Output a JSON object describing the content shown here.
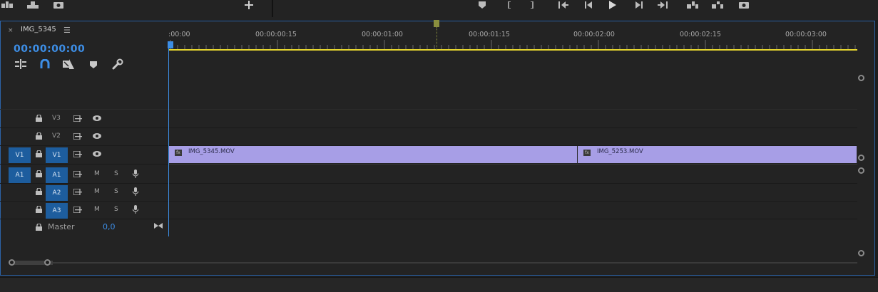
{
  "sequence": {
    "tab_title": "IMG_5345",
    "tab_close": "×",
    "tab_menu": "☰",
    "timecode": "00:00:00:00"
  },
  "ruler": {
    "labels": [
      ":00:00",
      "00:00:00:15",
      "00:00:01:00",
      "00:00:01:15",
      "00:00:02:00",
      "00:00:02:15",
      "00:00:03:00"
    ]
  },
  "tracks": {
    "video": [
      {
        "name": "V3",
        "target": "",
        "source_patch": ""
      },
      {
        "name": "V2",
        "target": "",
        "source_patch": ""
      },
      {
        "name": "V1",
        "target": "V1",
        "source_patch": "V1"
      }
    ],
    "audio": [
      {
        "name": "A1",
        "source_patch": "A1",
        "target": "A1",
        "mute": "M",
        "solo": "S"
      },
      {
        "name": "A2",
        "source_patch": "",
        "target": "A2",
        "mute": "M",
        "solo": "S"
      },
      {
        "name": "A3",
        "source_patch": "",
        "target": "A3",
        "mute": "M",
        "solo": "S"
      }
    ],
    "master": {
      "label": "Master",
      "value": "0,0"
    }
  },
  "clips": [
    {
      "name": "IMG_5345.MOV",
      "track": "V1",
      "fx": "fx"
    },
    {
      "name": "IMG_5253.MOV",
      "track": "V1",
      "fx": "fx"
    }
  ],
  "colors": {
    "accent": "#3d8ee6",
    "clip_video": "#a79ee6",
    "work_area": "#e6d62f",
    "track_target": "#1d5d9e",
    "panel_border": "#2c63a8"
  },
  "icons": {
    "top_toolbar": [
      "insert-icon",
      "export-frame-icon",
      "camera-icon",
      "add-icon",
      "marker-icon",
      "mark-in-icon",
      "mark-out-icon",
      "go-to-in-icon",
      "step-back-icon",
      "play-icon",
      "step-forward-icon",
      "go-to-out-icon",
      "lift-icon",
      "extract-icon",
      "export-frame-icon"
    ],
    "timeline_tools": [
      "nest-icon",
      "snap-icon",
      "linked-selection-icon",
      "add-marker-icon",
      "wrench-icon"
    ]
  }
}
